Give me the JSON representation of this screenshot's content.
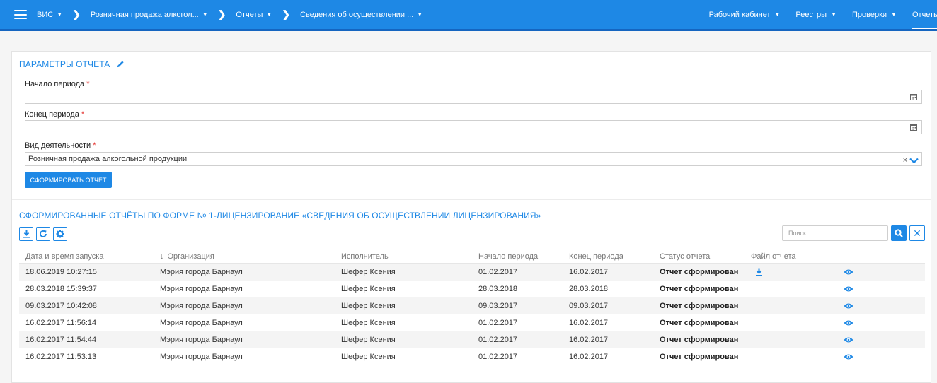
{
  "navbar": {
    "app": "ВИС",
    "crumbs": [
      "Розничная продажа алкогол...",
      "Отчеты",
      "Сведения об осуществлении ..."
    ],
    "right_items": [
      "Рабочий кабинет",
      "Реестры",
      "Проверки",
      "Отчеты"
    ]
  },
  "params": {
    "title": "ПАРАМЕТРЫ ОТЧЕТА",
    "start_label": "Начало периода",
    "start_value": "",
    "end_label": "Конец периода",
    "end_value": "",
    "activity_label": "Вид деятельности",
    "activity_value": "Розничная продажа алкогольной продукции",
    "required_mark": "*",
    "submit_label": "СФОРМИРОВАТЬ ОТЧЕТ"
  },
  "reports": {
    "title": "СФОРМИРОВАННЫЕ ОТЧЁТЫ ПО ФОРМЕ № 1-ЛИЦЕНЗИРОВАНИЕ «СВЕДЕНИЯ ОБ ОСУЩЕСТВЛЕНИИ ЛИЦЕНЗИРОВАНИЯ»",
    "search_placeholder": "Поиск",
    "columns": [
      "Дата и время запуска",
      "Организация",
      "Исполнитель",
      "Начало периода",
      "Конец периода",
      "Статус отчета",
      "Файл отчета"
    ],
    "sort_indicator": "↓",
    "rows": [
      {
        "started": "18.06.2019 10:27:15",
        "org": "Мэрия города Барнаул",
        "executor": "Шефер Ксения",
        "start": "01.02.2017",
        "end": "16.02.2017",
        "status": "Отчет сформирован",
        "has_file": true
      },
      {
        "started": "28.03.2018 15:39:37",
        "org": "Мэрия города Барнаул",
        "executor": "Шефер Ксения",
        "start": "28.03.2018",
        "end": "28.03.2018",
        "status": "Отчет сформирован",
        "has_file": false
      },
      {
        "started": "09.03.2017 10:42:08",
        "org": "Мэрия города Барнаул",
        "executor": "Шефер Ксения",
        "start": "09.03.2017",
        "end": "09.03.2017",
        "status": "Отчет сформирован",
        "has_file": false
      },
      {
        "started": "16.02.2017 11:56:14",
        "org": "Мэрия города Барнаул",
        "executor": "Шефер Ксения",
        "start": "01.02.2017",
        "end": "16.02.2017",
        "status": "Отчет сформирован",
        "has_file": false
      },
      {
        "started": "16.02.2017 11:54:44",
        "org": "Мэрия города Барнаул",
        "executor": "Шефер Ксения",
        "start": "01.02.2017",
        "end": "16.02.2017",
        "status": "Отчет сформирован",
        "has_file": false
      },
      {
        "started": "16.02.2017 11:53:13",
        "org": "Мэрия города Барнаул",
        "executor": "Шефер Ксения",
        "start": "01.02.2017",
        "end": "16.02.2017",
        "status": "Отчет сформирован",
        "has_file": false
      }
    ]
  },
  "colors": {
    "accent": "#1e88e5",
    "required": "#e53935"
  },
  "icons": [
    "menu-icon",
    "pencil-icon",
    "calendar-icon",
    "clear-icon",
    "chevron-down-icon",
    "download-icon",
    "refresh-icon",
    "gear-icon",
    "search-icon",
    "close-icon",
    "eye-icon"
  ]
}
